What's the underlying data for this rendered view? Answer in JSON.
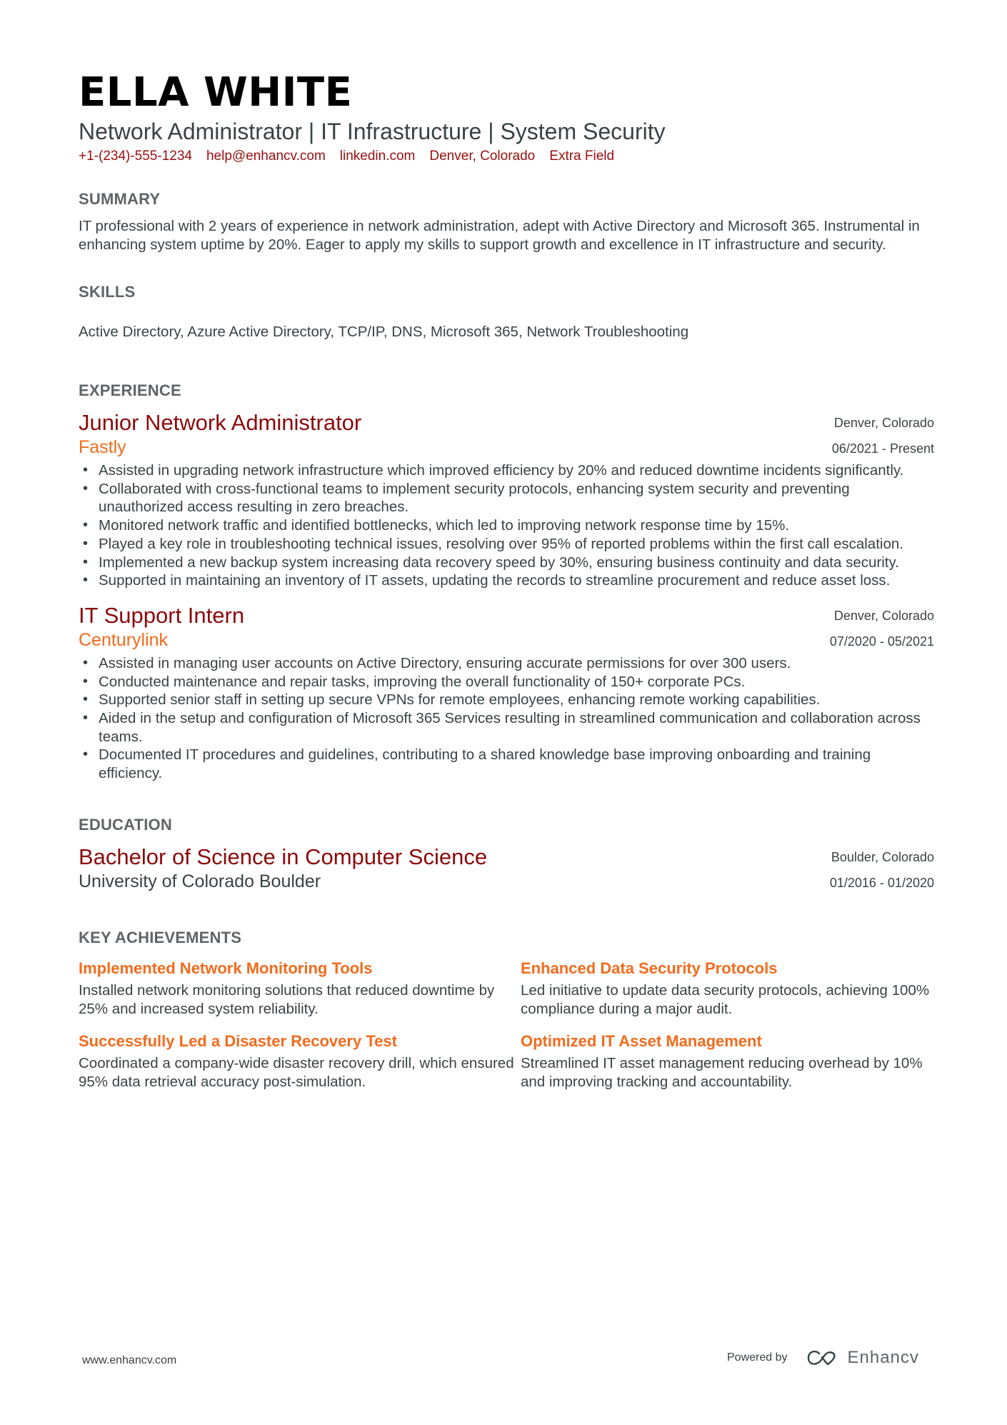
{
  "header": {
    "name": "ELLA WHITE",
    "headline": "Network Administrator | IT Infrastructure | System Security",
    "contacts": [
      "+1-(234)-555-1234",
      "help@enhancv.com",
      "linkedin.com",
      "Denver, Colorado",
      "Extra Field"
    ]
  },
  "summary": {
    "title": "SUMMARY",
    "text": "IT professional with 2 years of experience in network administration, adept with Active Directory and Microsoft 365. Instrumental in enhancing system uptime by 20%. Eager to apply my skills to support growth and excellence in IT infrastructure and security."
  },
  "skills": {
    "title": "SKILLS",
    "text": "Active Directory, Azure Active Directory, TCP/IP, DNS, Microsoft 365, Network Troubleshooting"
  },
  "experience": {
    "title": "EXPERIENCE",
    "entries": [
      {
        "role": "Junior Network Administrator",
        "company": "Fastly",
        "location": "Denver, Colorado",
        "dates": "06/2021 - Present",
        "bullets": [
          "Assisted in upgrading network infrastructure which improved efficiency by 20% and reduced downtime incidents significantly.",
          "Collaborated with cross-functional teams to implement security protocols, enhancing system security and preventing unauthorized access resulting in zero breaches.",
          "Monitored network traffic and identified bottlenecks, which led to improving network response time by 15%.",
          "Played a key role in troubleshooting technical issues, resolving over 95% of reported problems within the first call escalation.",
          "Implemented a new backup system increasing data recovery speed by 30%, ensuring business continuity and data security.",
          "Supported in maintaining an inventory of IT assets, updating the records to streamline procurement and reduce asset loss."
        ]
      },
      {
        "role": "IT Support Intern",
        "company": "Centurylink",
        "location": "Denver, Colorado",
        "dates": "07/2020 - 05/2021",
        "bullets": [
          "Assisted in managing user accounts on Active Directory, ensuring accurate permissions for over 300 users.",
          "Conducted maintenance and repair tasks, improving the overall functionality of 150+ corporate PCs.",
          "Supported senior staff in setting up secure VPNs for remote employees, enhancing remote working capabilities.",
          "Aided in the setup and configuration of Microsoft 365 Services resulting in streamlined communication and collaboration across teams.",
          "Documented IT procedures and guidelines, contributing to a shared knowledge base improving onboarding and training efficiency."
        ]
      }
    ]
  },
  "education": {
    "title": "EDUCATION",
    "degree": "Bachelor of Science in Computer Science",
    "school": "University of Colorado Boulder",
    "location": "Boulder, Colorado",
    "dates": "01/2016 - 01/2020"
  },
  "achievements": {
    "title": "KEY ACHIEVEMENTS",
    "items": [
      {
        "title": "Implemented Network Monitoring Tools",
        "desc": "Installed network monitoring solutions that reduced downtime by 25% and increased system reliability."
      },
      {
        "title": "Enhanced Data Security Protocols",
        "desc": "Led initiative to update data security protocols, achieving 100% compliance during a major audit."
      },
      {
        "title": "Successfully Led a Disaster Recovery Test",
        "desc": "Coordinated a company-wide disaster recovery drill, which ensured 95% data retrieval accuracy post-simulation."
      },
      {
        "title": "Optimized IT Asset Management",
        "desc": "Streamlined IT asset management reducing overhead by 10% and improving tracking and accountability."
      }
    ]
  },
  "footer": {
    "website": "www.enhancv.com",
    "powered_by": "Powered by",
    "brand": "Enhancv",
    "logo_icon": "enhancv-logo-icon"
  },
  "colors": {
    "accent": "#8b0a0a",
    "orange": "#f26b1d",
    "text": "#384347",
    "section": "#5d6568"
  }
}
